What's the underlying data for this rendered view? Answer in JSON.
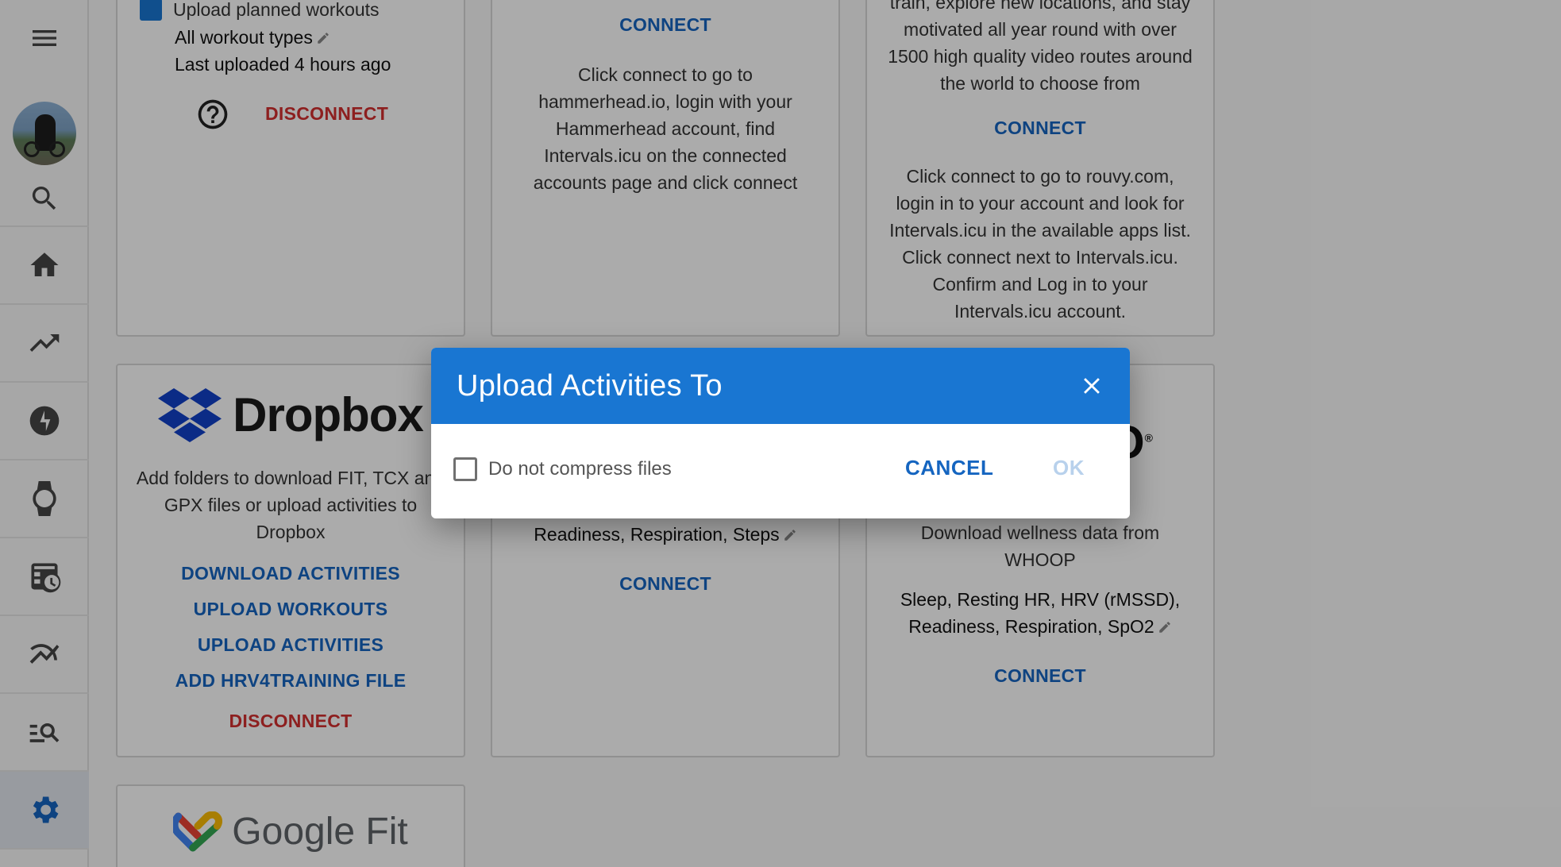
{
  "sidebar": {
    "items": [
      {
        "name": "menu-icon"
      },
      {
        "name": "avatar"
      },
      {
        "name": "search-icon"
      },
      {
        "name": "home-icon"
      },
      {
        "name": "trending-up-icon"
      },
      {
        "name": "bolt-icon"
      },
      {
        "name": "watch-icon"
      },
      {
        "name": "calendar-clock-icon"
      },
      {
        "name": "multiline-chart-icon"
      },
      {
        "name": "manage-search-icon"
      },
      {
        "name": "settings-icon",
        "active": true
      }
    ]
  },
  "cards": {
    "top_left": {
      "checkbox_label": "Upload planned workouts",
      "workout_types": "All workout types",
      "last_uploaded": "Last uploaded 4 hours ago",
      "disconnect": "DISCONNECT"
    },
    "hammerhead": {
      "connect": "CONNECT",
      "lines": [
        "Click connect to go to",
        "hammerhead.io, login with your",
        "Hammerhead account, find",
        "Intervals.icu on the connected",
        "accounts page and click connect"
      ]
    },
    "rouvy": {
      "intro_lines": [
        "train, explore new locations, and stay",
        "motivated all year round with over",
        "1500 high quality video routes around",
        "the world to choose from"
      ],
      "connect": "CONNECT",
      "lines": [
        "Click connect to go to rouvy.com,",
        "login in to your account and look for",
        "Intervals.icu in the available apps list.",
        "Click connect next to Intervals.icu.",
        "Confirm and Log in to your",
        "Intervals.icu account."
      ]
    },
    "dropbox": {
      "logo_text": "Dropbox",
      "desc_lines": [
        "Add folders to download FIT, TCX and",
        "GPX files or upload activities to",
        "Dropbox"
      ],
      "actions": [
        "DOWNLOAD ACTIVITIES",
        "UPLOAD WORKOUTS",
        "UPLOAD ACTIVITIES",
        "ADD HRV4TRAINING FILE"
      ],
      "disconnect": "DISCONNECT"
    },
    "middle": {
      "data_line": "Readiness, Respiration, Steps",
      "connect": "CONNECT"
    },
    "whoop": {
      "desc_lines": [
        "Download wellness data from",
        "WHOOP"
      ],
      "data_lines": [
        "Sleep, Resting HR, HRV (rMSSD),",
        "Readiness, Respiration, SpO2"
      ],
      "connect": "CONNECT"
    },
    "google_fit": {
      "logo_text": "Google Fit"
    }
  },
  "dialog": {
    "title": "Upload Activities To",
    "checkbox_label": "Do not compress files",
    "cancel": "CANCEL",
    "ok": "OK"
  }
}
